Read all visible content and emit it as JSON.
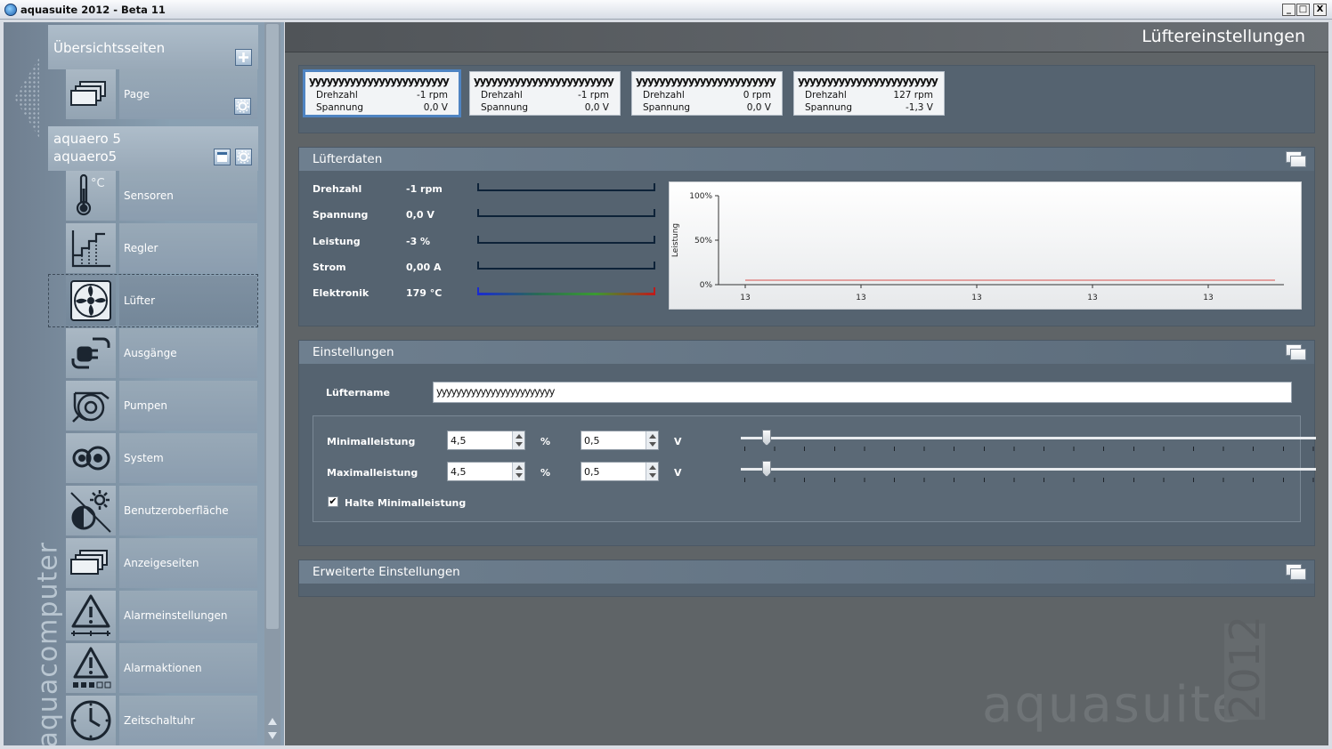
{
  "window": {
    "title": "aquasuite 2012 - Beta 11",
    "minimize": "_",
    "maximize": "□",
    "close": "X"
  },
  "sidebar": {
    "brand": "aquacomputer",
    "overview": {
      "title": "Übersichtsseiten",
      "add_icon": "+",
      "page_label": "Page"
    },
    "device": {
      "line1": "aquaero 5",
      "line2": "aquaero5"
    },
    "items": [
      {
        "label": "Sensoren",
        "icon": "thermometer-icon",
        "unit": "°C"
      },
      {
        "label": "Regler",
        "icon": "controller-icon"
      },
      {
        "label": "Lüfter",
        "icon": "fan-icon"
      },
      {
        "label": "Ausgänge",
        "icon": "plug-icon"
      },
      {
        "label": "Pumpen",
        "icon": "pump-icon"
      },
      {
        "label": "System",
        "icon": "system-icon"
      },
      {
        "label": "Benutzeroberfläche",
        "icon": "brightness-icon"
      },
      {
        "label": "Anzeigeseiten",
        "icon": "pages-icon"
      },
      {
        "label": "Alarmeinstellungen",
        "icon": "alarm-settings-icon"
      },
      {
        "label": "Alarmaktionen",
        "icon": "alarm-actions-icon"
      },
      {
        "label": "Zeitschaltuhr",
        "icon": "clock-icon"
      }
    ]
  },
  "header": {
    "title": "Lüftereinstellungen"
  },
  "background": {
    "logo": "aquasuite",
    "year": "2012"
  },
  "fan_tiles": [
    {
      "name": "yyyyyyyyyyyyyyyyyyyyyyyy",
      "l1": "Drehzahl",
      "v1": "-1 rpm",
      "l2": "Spannung",
      "v2": "0,0 V"
    },
    {
      "name": "yyyyyyyyyyyyyyyyyyyyyyyy",
      "l1": "Drehzahl",
      "v1": "-1 rpm",
      "l2": "Spannung",
      "v2": "0,0 V"
    },
    {
      "name": "yyyyyyyyyyyyyyyyyyyyyyyy",
      "l1": "Drehzahl",
      "v1": "0 rpm",
      "l2": "Spannung",
      "v2": "0,0 V"
    },
    {
      "name": "yyyyyyyyyyyyyyyyyyyyyyyy",
      "l1": "Drehzahl",
      "v1": "127 rpm",
      "l2": "Spannung",
      "v2": "-1,3 V"
    }
  ],
  "fan_data": {
    "title": "Lüfterdaten",
    "rows": [
      {
        "label": "Drehzahl",
        "value": "-1 rpm"
      },
      {
        "label": "Spannung",
        "value": "0,0 V"
      },
      {
        "label": "Leistung",
        "value": "-3 %"
      },
      {
        "label": "Strom",
        "value": "0,00 A"
      },
      {
        "label": "Elektronik",
        "value": "179 °C"
      }
    ]
  },
  "chart_data": {
    "type": "line",
    "ylabel": "Leistung",
    "ytick_labels": [
      "100%",
      "50%",
      "0%"
    ],
    "xtick_labels": [
      "13",
      "13",
      "13",
      "13",
      "13"
    ],
    "ylim": [
      0,
      100
    ],
    "series": [
      {
        "values": [
          5,
          5
        ],
        "color": "#d9534f"
      }
    ]
  },
  "settings": {
    "title": "Einstellungen",
    "name_label": "Lüftername",
    "name_value": "yyyyyyyyyyyyyyyyyyyyyyyy",
    "min_label": "Minimalleistung",
    "min_pct": "4,5",
    "min_pct_unit": "%",
    "min_volt": "0,5",
    "min_volt_unit": "V",
    "max_label": "Maximalleistung",
    "max_pct": "4,5",
    "max_pct_unit": "%",
    "max_volt": "0,5",
    "max_volt_unit": "V",
    "min_slider": 0.045,
    "max_slider": 0.045,
    "hold_label": "Halte Minimalleistung",
    "hold_checked": true
  },
  "advanced": {
    "title": "Erweiterte Einstellungen"
  },
  "colors": {
    "accent": "#4f84c2",
    "trend": "#d9534f",
    "panel": "#556370"
  }
}
